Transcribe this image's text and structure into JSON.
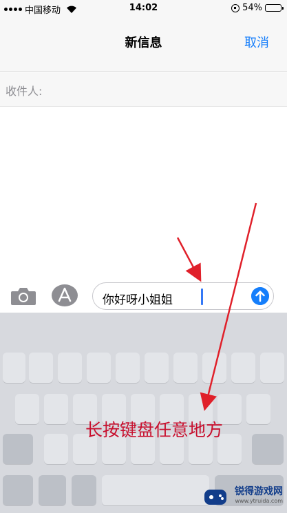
{
  "status_bar": {
    "carrier": "中国移动",
    "time": "14:02",
    "battery_percent": "54%",
    "battery_level": 0.54,
    "icons": [
      "signal-icon",
      "wifi-icon",
      "orientation-lock-icon",
      "battery-icon"
    ]
  },
  "nav": {
    "title": "新信息",
    "cancel_label": "取消"
  },
  "recipient": {
    "label": "收件人:",
    "value": ""
  },
  "compose": {
    "text": "你好呀小姐姐",
    "icons": [
      "camera-icon",
      "app-store-icon",
      "send-arrow-icon"
    ]
  },
  "annotation": {
    "text": "长按键盘任意地方"
  },
  "watermark": {
    "title": "锐得游戏网",
    "url": "www.ytruida.com"
  },
  "colors": {
    "accent": "#157efb",
    "caret": "#3478f6",
    "annotation": "#c8102e",
    "keyboard_bg": "#d7d9de"
  }
}
